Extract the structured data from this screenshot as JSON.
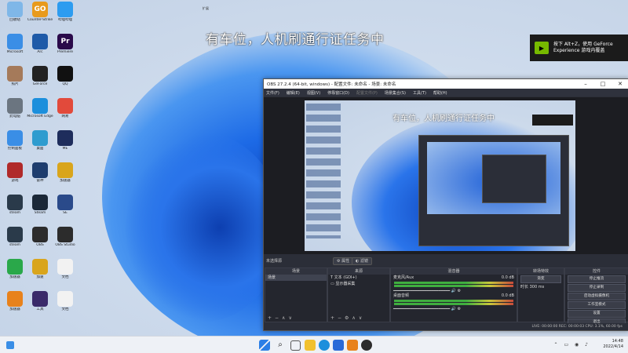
{
  "desktop": {
    "overlay_text": "有车位，人机刷通行证任务中",
    "overlay_small": "扩展",
    "icons": [
      {
        "label": "回收站",
        "color": "#7fb7e8"
      },
      {
        "label": "Counter-Strike",
        "color": "#e89a1c",
        "glyph": "GO"
      },
      {
        "label": "哔哩哔哩",
        "color": "#2d9cf0"
      },
      {
        "label": "Microsoft",
        "color": "#3a8ee6"
      },
      {
        "label": "Arc",
        "color": "#1e5aa8"
      },
      {
        "label": "Premiere",
        "color": "#2a0a4a",
        "glyph": "Pr"
      },
      {
        "label": "照片",
        "color": "#a57a5a"
      },
      {
        "label": "GeForce",
        "color": "#222222"
      },
      {
        "label": "QQ",
        "color": "#111111"
      },
      {
        "label": "此电脑",
        "color": "#6b7580"
      },
      {
        "label": "Microsoft Edge",
        "color": "#1c8fdc"
      },
      {
        "label": "网易",
        "color": "#e24a3b"
      },
      {
        "label": "控制面板",
        "color": "#3a8ee6"
      },
      {
        "label": "桌面",
        "color": "#2f9ccf"
      },
      {
        "label": "ME",
        "color": "#1e2d5c"
      },
      {
        "label": "游戏",
        "color": "#b02a2a"
      },
      {
        "label": "雷神",
        "color": "#1e3d6e"
      },
      {
        "label": "加速器",
        "color": "#d9a51c"
      },
      {
        "label": "steam",
        "color": "#2a3a4a"
      },
      {
        "label": "Steam",
        "color": "#1b2838"
      },
      {
        "label": "SE",
        "color": "#2a4a8a"
      },
      {
        "label": "steam",
        "color": "#2a3a4a"
      },
      {
        "label": "OBS",
        "color": "#2c2c2c"
      },
      {
        "label": "OBS Studio",
        "color": "#2c2c2c"
      },
      {
        "label": "加速器",
        "color": "#2aa84a"
      },
      {
        "label": "加速",
        "color": "#d9a51c"
      },
      {
        "label": "文档",
        "color": "#f2f2f2"
      },
      {
        "label": "加速器",
        "color": "#e8821c"
      },
      {
        "label": "工具",
        "color": "#3a2a6a"
      },
      {
        "label": "文档",
        "color": "#f2f2f2"
      }
    ]
  },
  "toast": {
    "line1": "按下 Alt+Z，使用 GeForce",
    "line2": "Experience 游戏内覆盖"
  },
  "obs": {
    "title": "OBS 27.2.4 (64-bit, windows) - 配置文件: 未命名 - 场景: 未命名",
    "menu": [
      "文件(F)",
      "编辑(E)",
      "视图(V)",
      "停靠窗口(D)",
      "配置文件(P)",
      "场景集合(S)",
      "工具(T)",
      "帮助(H)"
    ],
    "scene_none": "未选择源",
    "props_btn": "属性",
    "filter_btn": "滤镜",
    "docks": {
      "scenes": {
        "title": "场景",
        "items": [
          "场景"
        ]
      },
      "sources": {
        "title": "来源",
        "items": [
          "文本 (GDI+)",
          "显示器采集"
        ]
      },
      "mixer": {
        "title": "混音器",
        "ch1": "桌面音频",
        "ch2": "麦克风/Aux",
        "db1": "0.0 dB",
        "db2": "0.0 dB"
      },
      "transitions": {
        "title": "转场特效",
        "mode": "渐变",
        "duration_label": "时长",
        "duration": "300 ms"
      },
      "controls": {
        "title": "控件",
        "buttons": [
          "停止推流",
          "停止录制",
          "启动虚拟摄像机",
          "工作室模式",
          "设置",
          "退出"
        ]
      }
    },
    "status": "LIVE: 00:00:00    REC: 00:00:03    CPU: 3.1%, 60.00 fps"
  },
  "taskbar": {
    "time": "14:48",
    "date": "2022/4/14"
  }
}
